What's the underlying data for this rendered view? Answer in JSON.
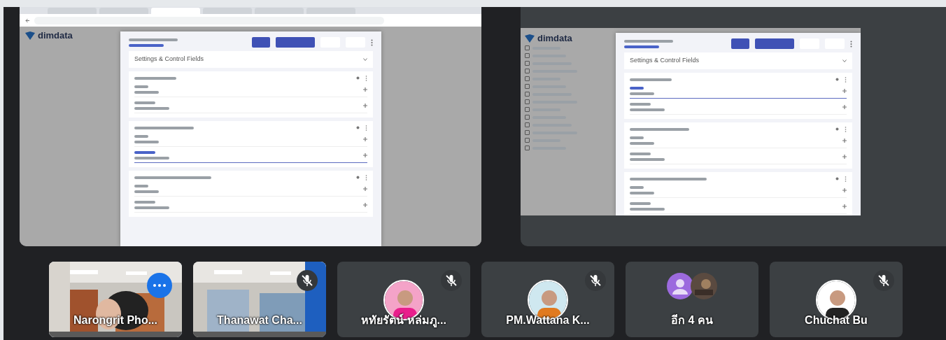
{
  "shared_screens": [
    {
      "kind": "browser",
      "tabs": [
        {
          "selected": false
        },
        {
          "selected": false
        },
        {
          "selected": true
        },
        {
          "selected": false
        },
        {
          "selected": false
        },
        {
          "selected": false
        }
      ],
      "logo": "dimdata",
      "dropdown": "Settings & Control Fields",
      "cards": [
        {
          "subfields": [
            {
              "focused": false
            },
            {
              "focused": false
            }
          ]
        },
        {
          "subfields": [
            {
              "focused": false
            },
            {
              "focused": true
            }
          ]
        },
        {
          "subfields": [
            {
              "focused": false
            },
            {
              "focused": false
            }
          ]
        }
      ]
    },
    {
      "kind": "window",
      "logo": "dimdata",
      "dropdown": "Settings & Control Fields",
      "sidebar_items": [
        {
          "checked": false
        },
        {
          "checked": false
        },
        {
          "checked": false
        },
        {
          "checked": false
        },
        {
          "checked": false
        },
        {
          "checked": false
        },
        {
          "checked": false
        },
        {
          "checked": false
        },
        {
          "checked": false
        },
        {
          "checked": false
        },
        {
          "checked": false
        },
        {
          "checked": false
        },
        {
          "checked": false
        },
        {
          "checked": false
        }
      ],
      "cards": [
        {
          "subfields": [
            {
              "focused": true
            },
            {
              "focused": false
            }
          ]
        },
        {
          "subfields": [
            {
              "focused": false
            },
            {
              "focused": false
            }
          ]
        },
        {
          "subfields": [
            {
              "focused": false
            },
            {
              "focused": false
            }
          ]
        }
      ]
    }
  ],
  "participants": [
    {
      "name": "Narongrit Pho...",
      "kind": "camera",
      "muted": false,
      "highlighted": true
    },
    {
      "name": "Thanawat Cha...",
      "kind": "camera",
      "muted": true,
      "highlighted": false
    },
    {
      "name": "หทัยรัตน์ หล่มภู...",
      "kind": "avatar",
      "muted": true,
      "highlighted": false
    },
    {
      "name": "PM.Wattana K...",
      "kind": "avatar",
      "muted": true,
      "highlighted": false
    },
    {
      "name": "อีก 4 คน",
      "kind": "group",
      "muted": false,
      "highlighted": false
    },
    {
      "name": "Chuchat Bu",
      "kind": "avatar",
      "muted": true,
      "highlighted": false
    }
  ]
}
